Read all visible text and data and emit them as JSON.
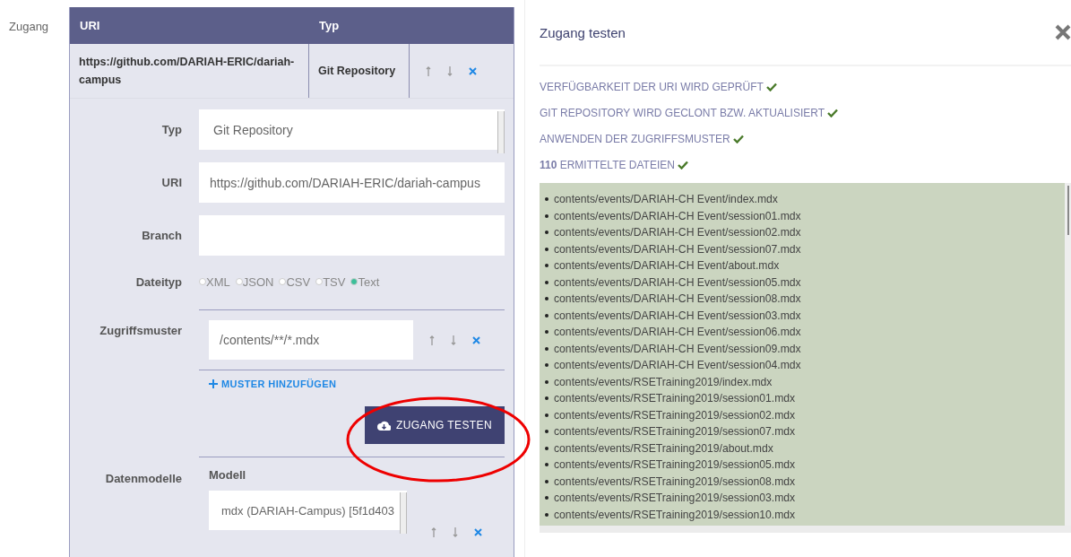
{
  "section_label": "Zugang",
  "table": {
    "columns": [
      "URI",
      "Typ"
    ],
    "rows": [
      {
        "uri": "https://github.com/DARIAH-ERIC/dariah-campus",
        "type": "Git Repository"
      }
    ]
  },
  "form": {
    "typ": {
      "label": "Typ",
      "value": "Git Repository"
    },
    "uri": {
      "label": "URI",
      "value": "https://github.com/DARIAH-ERIC/dariah-campus"
    },
    "branch": {
      "label": "Branch"
    },
    "dateityp": {
      "label": "Dateityp",
      "options": [
        {
          "label": "XML",
          "selected": false
        },
        {
          "label": "JSON",
          "selected": false
        },
        {
          "label": "CSV",
          "selected": false
        },
        {
          "label": "TSV",
          "selected": false
        },
        {
          "label": "Text",
          "selected": true
        }
      ]
    },
    "zugriffsmuster": {
      "label": "Zugriffsmuster",
      "patterns": [
        "/contents/**/*.mdx"
      ],
      "add_label": "MUSTER HINZUFÜGEN"
    },
    "test_button": "ZUGANG TESTEN",
    "datenmodelle": {
      "label": "Datenmodelle",
      "column": "Modell",
      "value": "mdx (DARIAH-Campus) [5f1d403"
    }
  },
  "dialog": {
    "title": "Zugang testen",
    "steps": [
      {
        "text": "VERFÜGBARKEIT DER URI WIRD GEPRÜFT",
        "done": true
      },
      {
        "text": "GIT REPOSITORY WIRD GECLONT BZW. AKTUALISIERT",
        "done": true
      },
      {
        "text": "ANWENDEN DER ZUGRIFFSMUSTER",
        "done": true
      },
      {
        "text": "**110** ERMITTELTE DATEIEN",
        "done": true
      }
    ],
    "files": [
      "contents/events/DARIAH-CH Event/index.mdx",
      "contents/events/DARIAH-CH Event/session01.mdx",
      "contents/events/DARIAH-CH Event/session02.mdx",
      "contents/events/DARIAH-CH Event/session07.mdx",
      "contents/events/DARIAH-CH Event/about.mdx",
      "contents/events/DARIAH-CH Event/session05.mdx",
      "contents/events/DARIAH-CH Event/session08.mdx",
      "contents/events/DARIAH-CH Event/session03.mdx",
      "contents/events/DARIAH-CH Event/session06.mdx",
      "contents/events/DARIAH-CH Event/session09.mdx",
      "contents/events/DARIAH-CH Event/session04.mdx",
      "contents/events/RSETraining2019/index.mdx",
      "contents/events/RSETraining2019/session01.mdx",
      "contents/events/RSETraining2019/session02.mdx",
      "contents/events/RSETraining2019/session07.mdx",
      "contents/events/RSETraining2019/about.mdx",
      "contents/events/RSETraining2019/session05.mdx",
      "contents/events/RSETraining2019/session08.mdx",
      "contents/events/RSETraining2019/session03.mdx",
      "contents/events/RSETraining2019/session10.mdx"
    ]
  }
}
